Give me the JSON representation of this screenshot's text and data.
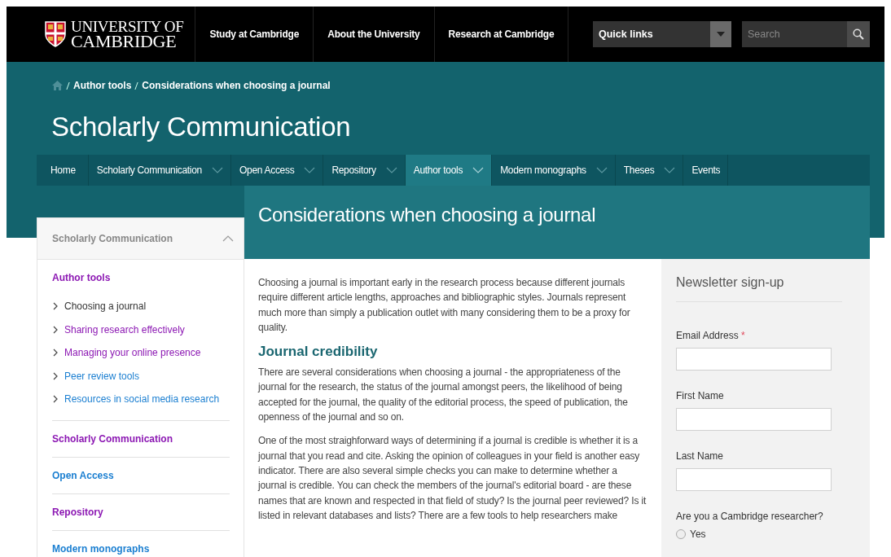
{
  "header": {
    "logo_lines": [
      "UNIVERSITY OF",
      "CAMBRIDGE"
    ],
    "links": [
      "Study at Cambridge",
      "About the University",
      "Research at Cambridge"
    ],
    "quick_links": "Quick links",
    "search": {
      "placeholder": "Search"
    }
  },
  "breadcrumb": [
    "Author tools",
    "Considerations when choosing a journal"
  ],
  "site_title": "Scholarly Communication",
  "nav": [
    {
      "label": "Home",
      "selected": false,
      "dropdown": false
    },
    {
      "label": "Scholarly Communication",
      "selected": false,
      "dropdown": true
    },
    {
      "label": "Open Access",
      "selected": false,
      "dropdown": true
    },
    {
      "label": "Repository",
      "selected": false,
      "dropdown": true
    },
    {
      "label": "Author tools",
      "selected": true,
      "dropdown": true
    },
    {
      "label": "Modern monographs",
      "selected": false,
      "dropdown": true
    },
    {
      "label": "Theses",
      "selected": false,
      "dropdown": true
    },
    {
      "label": "Events",
      "selected": false,
      "dropdown": false
    }
  ],
  "sidebar": {
    "heading": "Scholarly Communication",
    "expanded": true,
    "sections": [
      {
        "label": "Author tools",
        "visited": true,
        "children": [
          {
            "label": "Choosing a journal",
            "selected": true
          },
          {
            "label": "Sharing research effectively",
            "selected": false,
            "visited": true
          },
          {
            "label": "Managing your online presence",
            "selected": false,
            "visited": true
          },
          {
            "label": "Peer review tools",
            "selected": false,
            "visited": false
          },
          {
            "label": "Resources in social media research",
            "selected": false,
            "visited": false
          }
        ]
      },
      {
        "label": "Scholarly Communication",
        "visited": true
      },
      {
        "label": "Open Access",
        "visited": false
      },
      {
        "label": "Repository",
        "visited": true
      },
      {
        "label": "Modern monographs",
        "visited": false
      }
    ]
  },
  "page_title": "Considerations when choosing a journal",
  "article": [
    {
      "kind": "paragraph",
      "text": "Choosing a journal is important early in the research process because different journals require different article lengths, approaches and bibliographic styles. Journals represent much more than simply a publication outlet with many considering them to be a proxy for quality."
    },
    {
      "kind": "heading",
      "text": "Journal credibility"
    },
    {
      "kind": "paragraph",
      "text": "There are several considerations when choosing a journal - the appropriateness of the journal for the research, the status of the journal amongst peers, the likelihood of being accepted for the journal, the quality of the editorial process, the speed of publication, the openness of the journal and so on."
    },
    {
      "kind": "paragraph",
      "text": "One of the most straighforward ways of determining if a journal is credible is whether it is a journal that you read and cite. Asking the opinion of colleagues in your field is another easy indicator. There are also several simple checks you can make to determine whether a journal is credible. You can check the members of the journal's editorial board - are these names that are known and respected in that field of study? Is the journal peer reviewed? Is it listed in relevant databases and lists? There are a few tools to help researchers make"
    }
  ],
  "newsletter": {
    "title": "Newsletter sign-up",
    "fields": [
      {
        "label": "Email Address",
        "required": true,
        "marker": "*"
      },
      {
        "label": "First Name",
        "required": false
      },
      {
        "label": "Last Name",
        "required": false
      }
    ],
    "question": "Are you a Cambridge researcher?",
    "options": [
      {
        "label": "Yes",
        "selected": false
      }
    ]
  }
}
